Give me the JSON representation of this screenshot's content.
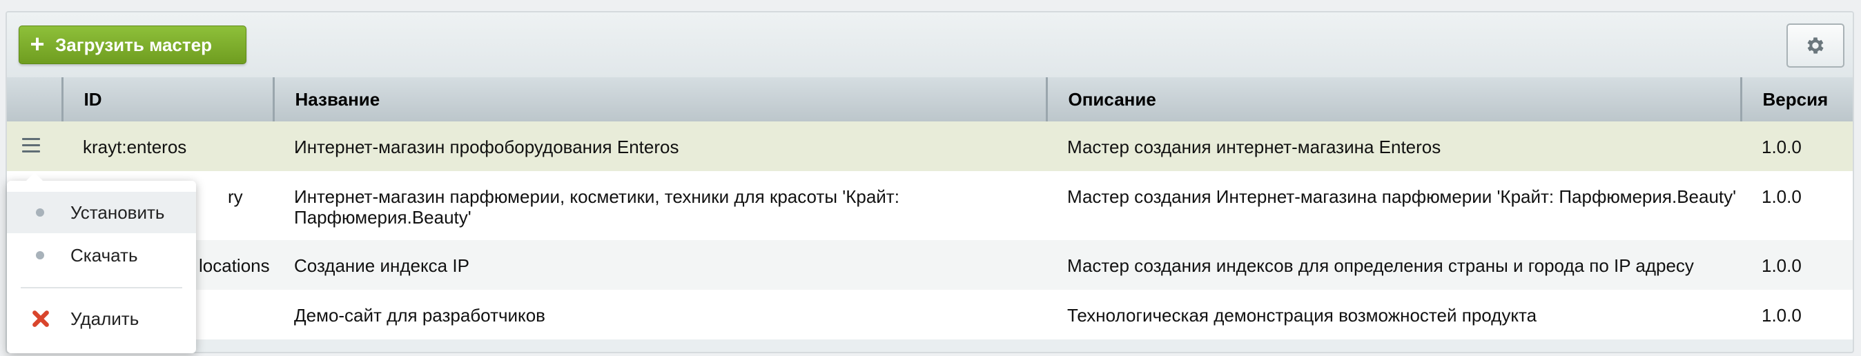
{
  "toolbar": {
    "add_button_label": "Загрузить мастер",
    "add_button_icon": "plus-icon",
    "settings_icon": "gear-icon"
  },
  "table": {
    "columns": [
      "",
      "ID",
      "Название",
      "Описание",
      "Версия"
    ],
    "rows": [
      {
        "id": "krayt:enteros",
        "name": "Интернет-магазин профоборудования Enteros",
        "description": "Мастер создания интернет-магазина Enteros",
        "version": "1.0.0"
      },
      {
        "id": "ry",
        "name": "Интернет-магазин парфюмерии, косметики, техники для красоты 'Крайт: Парфюмерия.Beauty'",
        "description": "Мастер создания Интернет-магазина парфюмерии 'Крайт: Парфюмерия.Beauty'",
        "version": "1.0.0"
      },
      {
        "id": "locations",
        "name": "Создание индекса IP",
        "description": "Мастер создания индексов для определения страны и города по IP адресу",
        "version": "1.0.0"
      },
      {
        "id": "",
        "name": "Демо-сайт для разработчиков",
        "description": "Технологическая демонстрация возможностей продукта",
        "version": "1.0.0"
      }
    ]
  },
  "context_menu": {
    "items": [
      {
        "label": "Установить",
        "icon": "bullet-icon"
      },
      {
        "label": "Скачать",
        "icon": "bullet-icon"
      },
      {
        "label": "Удалить",
        "icon": "delete-icon"
      }
    ]
  },
  "colors": {
    "accent_green": "#7aab2a",
    "active_row": "#e8ecd9",
    "delete_red": "#d9452c"
  }
}
